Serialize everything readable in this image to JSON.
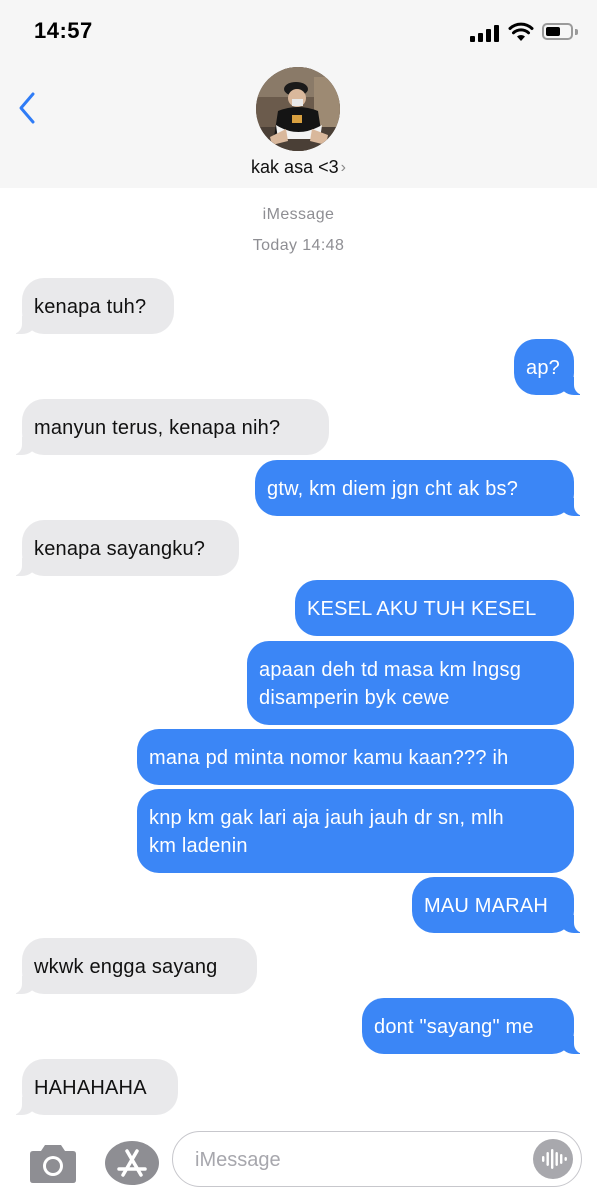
{
  "status_bar": {
    "time": "14:57",
    "icons": [
      "cellular-signal-icon",
      "wifi-icon",
      "battery-icon"
    ]
  },
  "header": {
    "back_icon": "chevron-left-icon",
    "contact_name": "kak asa <3",
    "contact_chevron": "›",
    "accent_color": "#2f7cf6"
  },
  "conversation": {
    "service": "iMessage",
    "timestamp": "Today 14:48",
    "messages": [
      {
        "from": "them",
        "text": [
          "kenapa tuh?"
        ]
      },
      {
        "from": "me",
        "text": [
          "ap?"
        ]
      },
      {
        "from": "them",
        "text": [
          "manyun terus, kenapa nih?"
        ]
      },
      {
        "from": "me",
        "text": [
          "gtw, km diem jgn cht ak bs?"
        ]
      },
      {
        "from": "them",
        "text": [
          "kenapa sayangku?"
        ]
      },
      {
        "from": "me",
        "text": [
          "KESEL AKU TUH KESEL"
        ]
      },
      {
        "from": "me",
        "text": [
          "apaan deh td masa km lngsg",
          "disamperin byk cewe"
        ]
      },
      {
        "from": "me",
        "text": [
          "mana pd minta nomor kamu kaan??? ih"
        ]
      },
      {
        "from": "me",
        "text": [
          "knp km gak lari aja jauh jauh dr sn, mlh",
          "km ladenin"
        ]
      },
      {
        "from": "me",
        "text": [
          "MAU MARAH"
        ]
      },
      {
        "from": "them",
        "text": [
          "wkwk engga sayang"
        ]
      },
      {
        "from": "me",
        "text": [
          "dont \"sayang\" me"
        ]
      },
      {
        "from": "them",
        "text": [
          "HAHAHAHA"
        ]
      }
    ]
  },
  "colors": {
    "outgoing_bubble": "#3b86f6",
    "incoming_bubble": "#e9e9eb",
    "header_background": "#f6f6f6"
  },
  "input_bar": {
    "camera_icon": "camera-icon",
    "apps_icon": "app-store-icon",
    "placeholder": "iMessage",
    "audio_icon": "audio-waveform-icon"
  }
}
